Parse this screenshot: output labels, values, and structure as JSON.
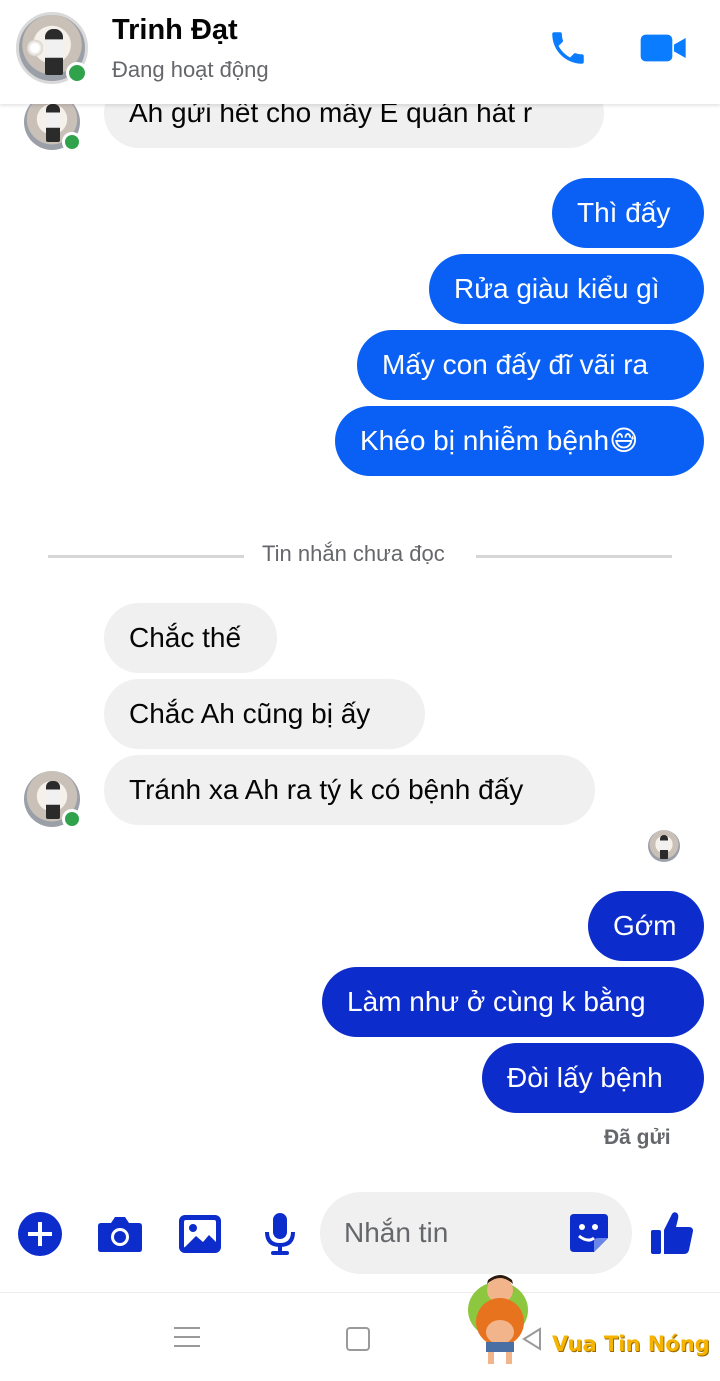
{
  "header": {
    "contact_name": "Trinh Đạt",
    "status": "Đang hoạt động",
    "call_icon": "phone-icon",
    "video_icon": "video-camera-icon",
    "accent_color": "#0a7cff"
  },
  "messages": [
    {
      "side": "incoming",
      "text": "Ah gửi hết cho mấy E quán hát r"
    },
    {
      "side": "outgoing",
      "text": "Thì đấy"
    },
    {
      "side": "outgoing",
      "text": "Rửa giàu kiểu gì"
    },
    {
      "side": "outgoing",
      "text": "Mấy con đấy đĩ vãi ra"
    },
    {
      "side": "outgoing",
      "text": "Khéo bị nhiễm bệnh😅"
    },
    {
      "side": "incoming",
      "text": "Chắc thế"
    },
    {
      "side": "incoming",
      "text": "Chắc Ah cũng bị ấy"
    },
    {
      "side": "incoming",
      "text": "Tránh xa Ah ra tý k có bệnh đấy"
    },
    {
      "side": "outgoing",
      "text": "Gớm"
    },
    {
      "side": "outgoing",
      "text": "Làm như ở cùng k bằng"
    },
    {
      "side": "outgoing",
      "text": "Đòi lấy bệnh"
    }
  ],
  "divider": {
    "text": "Tin nhắn chưa đọc"
  },
  "sent_status": "Đã gửi",
  "composer": {
    "placeholder": "Nhắn tin",
    "icons": [
      "plus-icon",
      "camera-icon",
      "image-icon",
      "microphone-icon",
      "sticker-icon",
      "thumbs-up-icon"
    ]
  },
  "navbar": {
    "icons": [
      "menu-icon",
      "home-icon",
      "back-icon"
    ]
  },
  "watermark": {
    "text": "Vua Tin Nóng"
  },
  "colors": {
    "bubble_incoming": "#f0f0f0",
    "bubble_outgoing_light": "#0a60f5",
    "bubble_outgoing_dark": "#0d2ccc",
    "online": "#31a24c"
  }
}
